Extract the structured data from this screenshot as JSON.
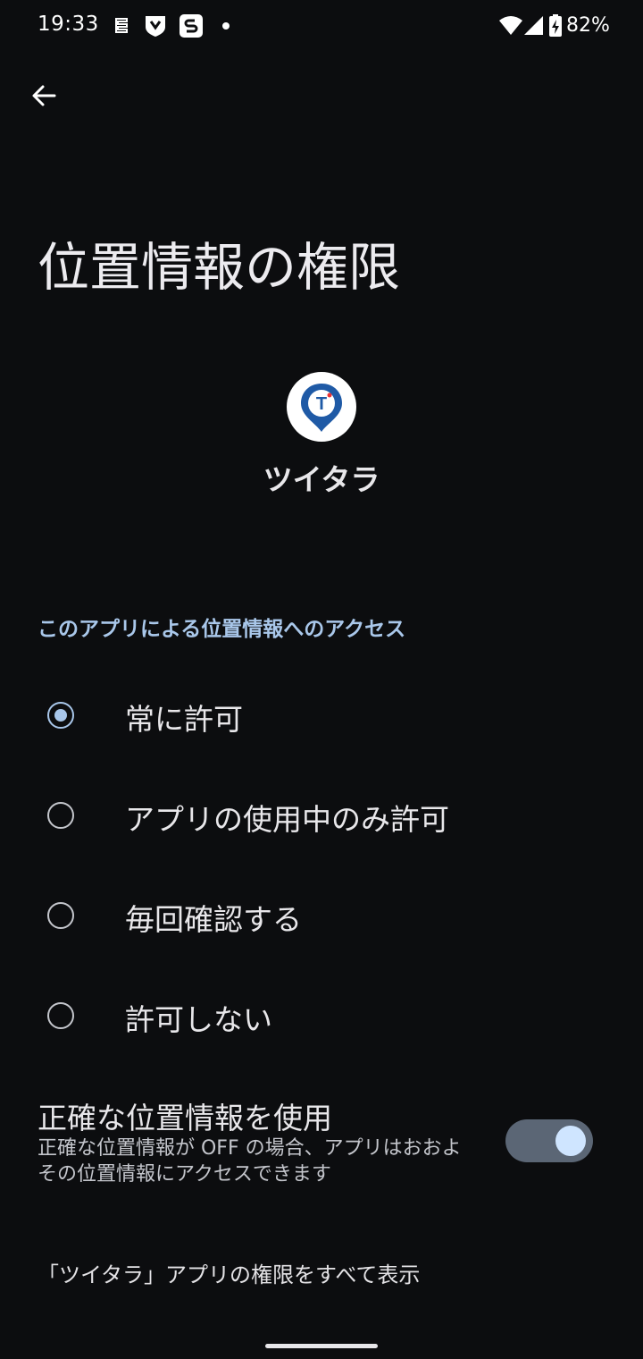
{
  "status_bar": {
    "time": "19:33",
    "battery_percent": "82%",
    "icons": [
      "notification-app-icon",
      "shield-app-icon",
      "s-app-icon",
      "dot-icon",
      "wifi-icon",
      "signal-icon",
      "battery-charging-icon"
    ]
  },
  "header": {
    "title": "位置情報の権限"
  },
  "app": {
    "name": "ツイタラ",
    "icon_letter": "T"
  },
  "section": {
    "header": "このアプリによる位置情報へのアクセス"
  },
  "options": [
    {
      "label": "常に許可",
      "checked": true
    },
    {
      "label": "アプリの使用中のみ許可",
      "checked": false
    },
    {
      "label": "毎回確認する",
      "checked": false
    },
    {
      "label": "許可しない",
      "checked": false
    }
  ],
  "precise_location": {
    "title": "正確な位置情報を使用",
    "description": "正確な位置情報が OFF の場合、アプリはおおよその位置情報にアクセスできます",
    "enabled": true
  },
  "footer": {
    "all_permissions_link": "「ツイタラ」アプリの権限をすべて表示"
  },
  "colors": {
    "background": "#0c0d0f",
    "accent": "#a9c7ea",
    "toggle_track": "#5b6675",
    "toggle_knob": "#cfe5ff",
    "app_icon_blue": "#1f5aa6"
  }
}
